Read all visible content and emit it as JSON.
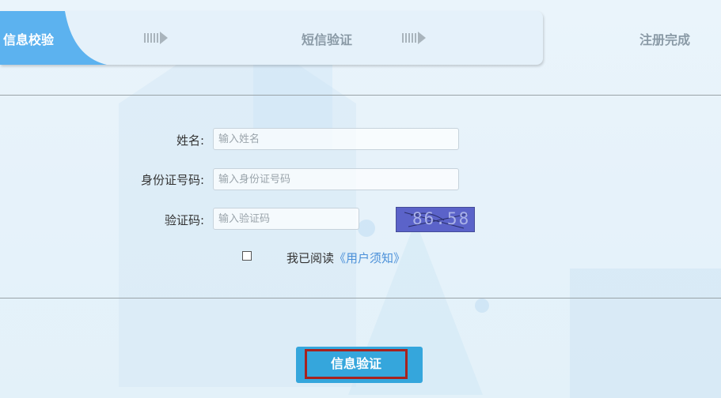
{
  "steps": [
    {
      "label": "信息校验",
      "active": true
    },
    {
      "label": "短信验证",
      "active": false
    },
    {
      "label": "注册完成",
      "active": false
    }
  ],
  "form": {
    "name": {
      "label": "姓名:",
      "placeholder": "输入姓名",
      "value": ""
    },
    "id_number": {
      "label": "身份证号码:",
      "placeholder": "输入身份证号码",
      "value": ""
    },
    "captcha": {
      "label": "验证码:",
      "placeholder": "输入验证码",
      "value": "",
      "image_text": "86.58"
    },
    "agreement": {
      "prefix": "我已阅读",
      "link": "《用户须知》",
      "checked": false
    }
  },
  "submit": {
    "label": "信息验证"
  },
  "colors": {
    "active_step": "#5cb2ef",
    "submit_bg": "#35a6dc",
    "submit_highlight_border": "#a8221e",
    "link": "#4a90d9"
  },
  "icons": [
    "step-arrow-icon",
    "step-arrow-icon"
  ]
}
